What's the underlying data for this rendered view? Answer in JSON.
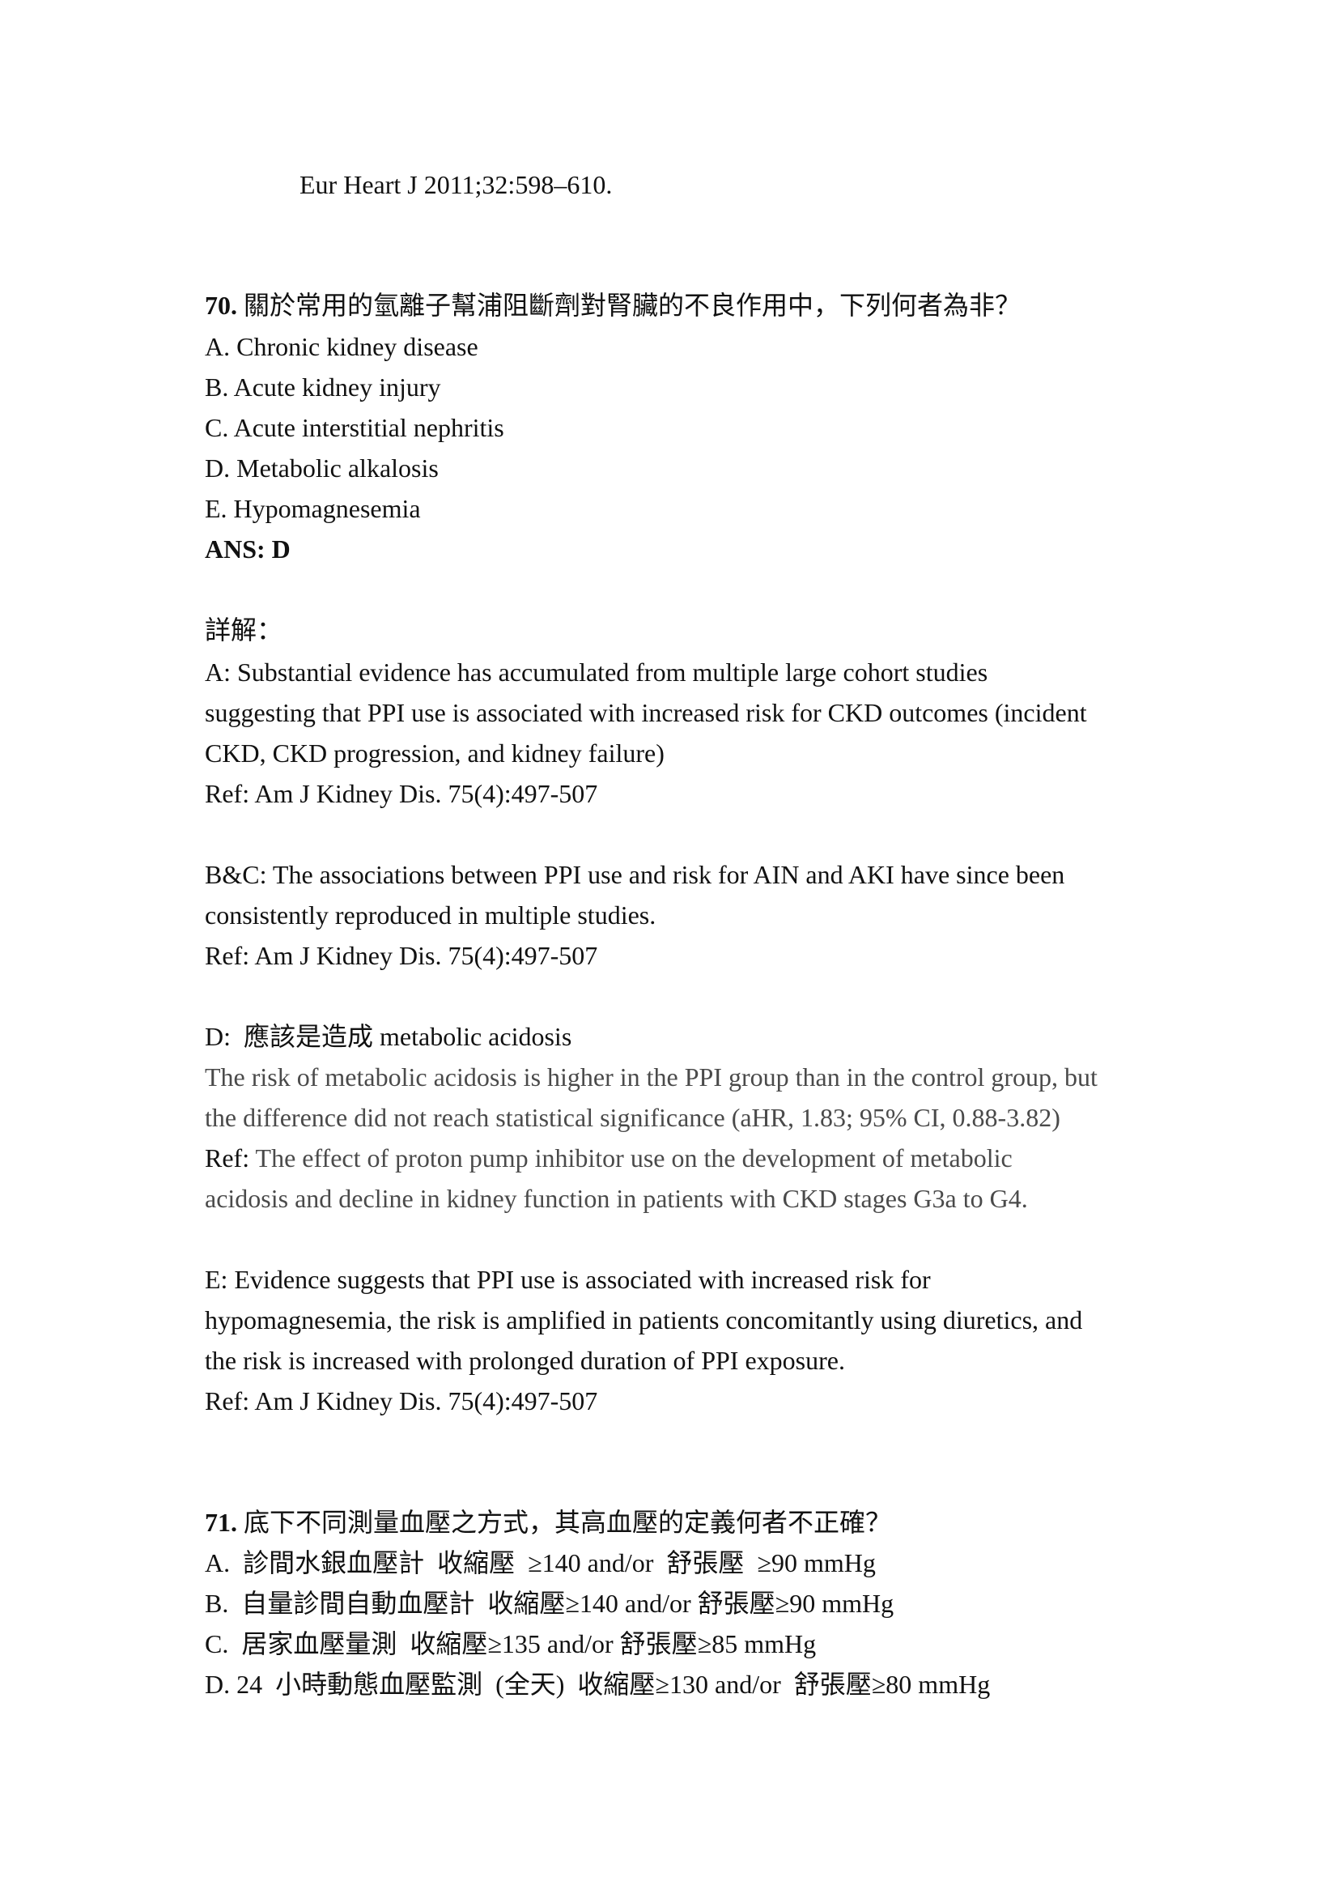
{
  "top_citation": "Eur Heart J 2011;32:598–610.",
  "q70": {
    "number": "70.",
    "stem": " 關於常用的氫離子幫浦阻斷劑對腎臟的不良作用中，下列何者為非？",
    "options": [
      "A. Chronic kidney disease",
      "B. Acute kidney injury",
      "C. Acute interstitial nephritis",
      "D. Metabolic alkalosis",
      "E. Hypomagnesemia"
    ],
    "answer": "ANS: D",
    "explain_heading": "詳解：",
    "explain_a": [
      "A: Substantial evidence has accumulated from multiple large cohort studies",
      "suggesting that PPI use is associated with increased risk for CKD outcomes (incident",
      "CKD, CKD progression, and kidney failure)",
      "Ref: Am J Kidney Dis. 75(4):497-507"
    ],
    "explain_bc": [
      "B&C: The associations between PPI use and risk for AIN and AKI have since been",
      "consistently reproduced in multiple studies.",
      "Ref: Am J Kidney Dis. 75(4):497-507"
    ],
    "explain_d_heading": "D:  應該是造成 metabolic acidosis",
    "explain_d": [
      "The risk of metabolic acidosis is higher in the PPI group than in the control group, but",
      "the difference did not reach statistical significance (aHR, 1.83; 95% CI, 0.88-3.82)"
    ],
    "explain_d_ref_label": "Ref: ",
    "explain_d_ref": [
      "The effect of proton pump inhibitor use on the development of metabolic",
      "acidosis and decline in kidney function in patients with CKD stages G3a to G4."
    ],
    "explain_e": [
      "E: Evidence suggests that PPI use is associated with increased risk for",
      "hypomagnesemia, the risk is amplified in patients concomitantly using diuretics, and",
      "the risk is increased with prolonged duration of PPI exposure.",
      "Ref: Am J Kidney Dis. 75(4):497-507"
    ]
  },
  "q71": {
    "number": "71.",
    "stem": " 底下不同測量血壓之方式，其高血壓的定義何者不正確？",
    "options": [
      "A.  診間水銀血壓計  收縮壓  ≥140 and/or  舒張壓  ≥90 mmHg",
      "B.  自量診間自動血壓計  收縮壓≥140 and/or 舒張壓≥90 mmHg",
      "C.  居家血壓量測  收縮壓≥135 and/or 舒張壓≥85 mmHg",
      "D. 24  小時動態血壓監測  (全天)  收縮壓≥130 and/or  舒張壓≥80 mmHg"
    ]
  }
}
